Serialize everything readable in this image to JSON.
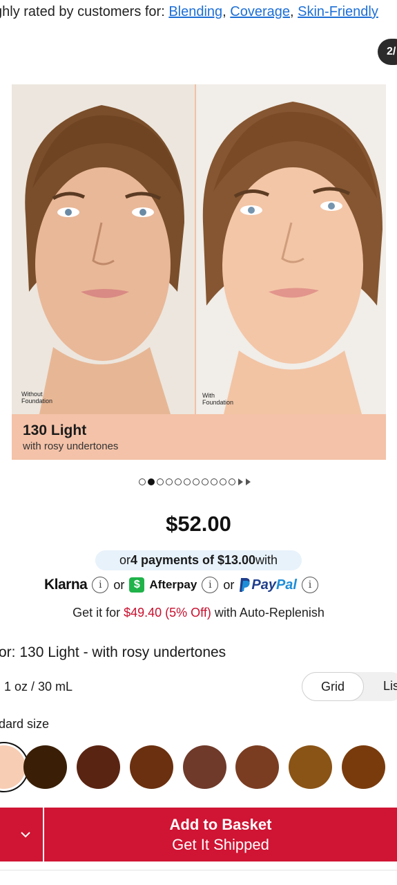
{
  "rating": {
    "prefix": "ghly rated by customers for: ",
    "tags": [
      "Blending",
      "Coverage",
      "Skin-Friendly"
    ],
    "sep": ", "
  },
  "gallery": {
    "counter": "2/",
    "left_caption": "Without\nFoundation",
    "right_caption": "With\nFoundation",
    "shade_name": "130 Light",
    "shade_desc": "with rosy undertones",
    "dots_total": 11,
    "active_dot": 1
  },
  "price": "$52.00",
  "installments": {
    "pre": "or ",
    "bold": "4 payments of $13.00",
    "post": " with"
  },
  "payments": {
    "klarna": "Klarna",
    "or": "or",
    "afterpay": "Afterpay",
    "paypal_a": "Pay",
    "paypal_b": "Pal",
    "info": "i"
  },
  "auto_replenish": {
    "pre": "Get it for ",
    "red": "$49.40 (5% Off)",
    "post": " with Auto-Replenish"
  },
  "color_label": "or: 130 Light - with rosy undertones",
  "size_label": "1 oz / 30 mL",
  "view_toggle": {
    "grid": "Grid",
    "list": "Lis"
  },
  "standard_size": "dard size",
  "swatches": [
    {
      "name": "130 Light",
      "color": "#f7cdb4",
      "selected": true
    },
    {
      "name": "shade-2",
      "color": "#3a1f06",
      "selected": false
    },
    {
      "name": "shade-3",
      "color": "#5a2412",
      "selected": false
    },
    {
      "name": "shade-4",
      "color": "#6b300f",
      "selected": false
    },
    {
      "name": "shade-5",
      "color": "#6f3a2a",
      "selected": false
    },
    {
      "name": "shade-6",
      "color": "#7a3d22",
      "selected": false
    },
    {
      "name": "shade-7",
      "color": "#8a5416",
      "selected": false
    },
    {
      "name": "shade-8",
      "color": "#7a3b0c",
      "selected": false
    }
  ],
  "cta": {
    "line1": "Add to Basket",
    "line2": "Get It Shipped"
  },
  "colors": {
    "brand_red": "#d01433",
    "link_blue": "#1d6fd6",
    "price_red": "#c8102e"
  }
}
